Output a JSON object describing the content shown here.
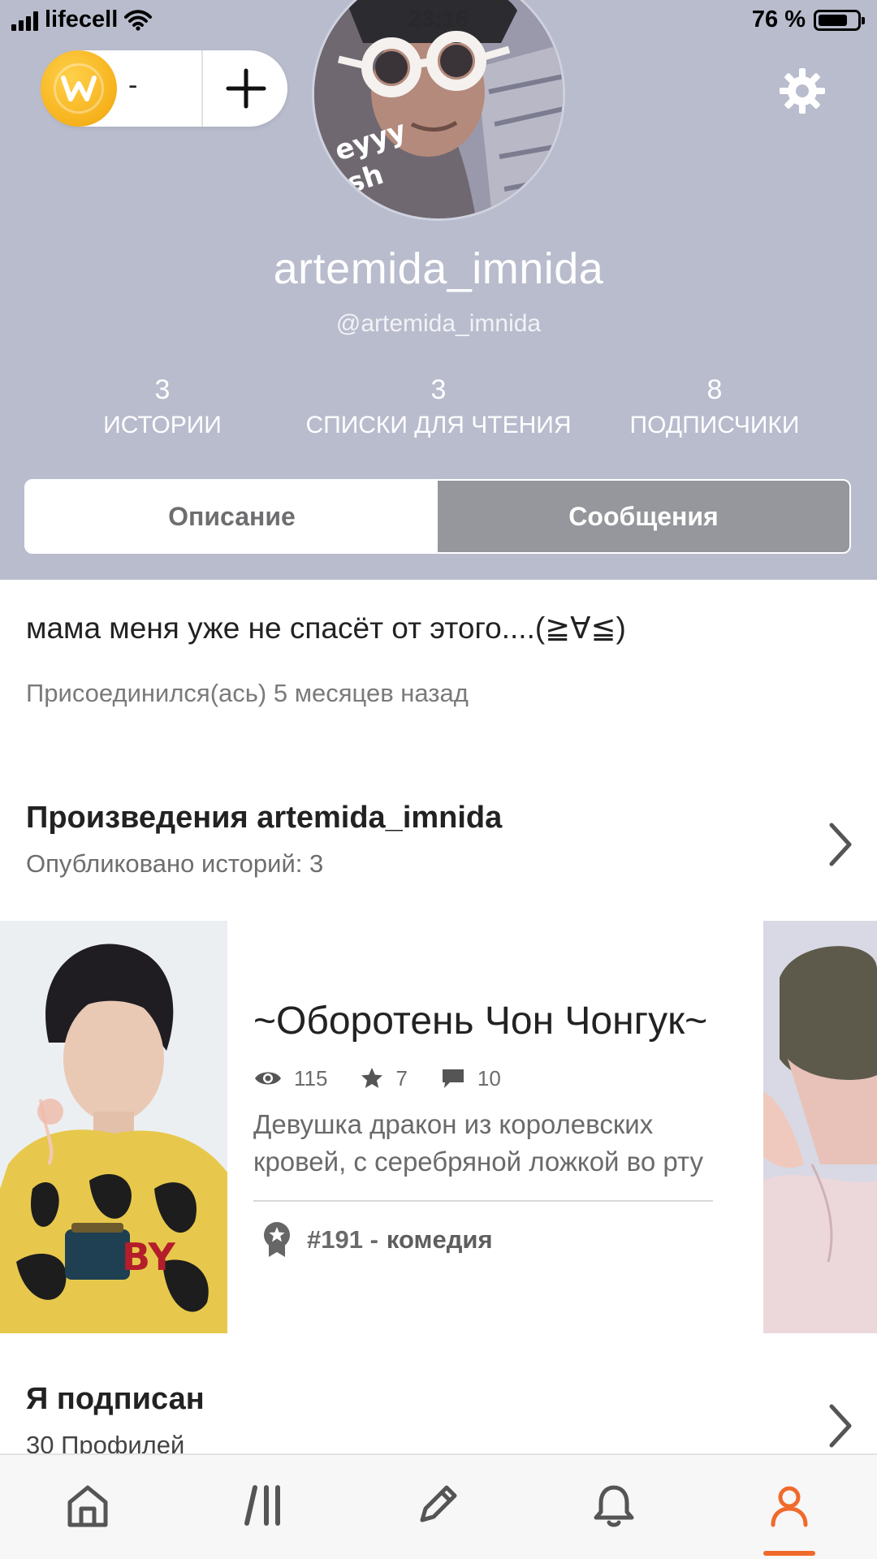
{
  "status_bar": {
    "carrier": "lifecell",
    "time": "23:16",
    "battery_percent": "76 %",
    "battery_level": 0.76
  },
  "coins": {
    "count": "-"
  },
  "profile": {
    "display_name": "artemida_imnida",
    "handle": "@artemida_imnida",
    "stats": [
      {
        "value": "3",
        "label": "ИСТОРИИ"
      },
      {
        "value": "3",
        "label": "СПИСКИ ДЛЯ ЧТЕНИЯ"
      },
      {
        "value": "8",
        "label": "ПОДПИСЧИКИ"
      }
    ],
    "tabs": [
      {
        "label": "Описание",
        "selected": true
      },
      {
        "label": "Сообщения",
        "selected": false
      }
    ],
    "bio": "мама меня уже не спасёт от этого....(≧∀≦)",
    "joined": "Присоединился(ась) 5 месяцев назад"
  },
  "works": {
    "title_prefix": "Произведения",
    "title_user": "artemida_imnida",
    "subtitle": "Опубликовано историй: 3",
    "story": {
      "title": "~Оборотень Чон Чонгук~",
      "views": "115",
      "votes": "7",
      "comments": "10",
      "desc_line1": "Девушка дракон из королевских",
      "desc_line2": "кровей, с серебряной ложкой во рту",
      "rank": "#191 -",
      "genre": "комедия"
    }
  },
  "following": {
    "title": "Я подписан",
    "subtitle": "30 Профилей"
  },
  "tabbar": {
    "items": [
      "home-icon",
      "library-icon",
      "write-icon",
      "notifications-icon",
      "profile-icon"
    ],
    "active": "profile-icon",
    "accent": "#f06a2b"
  },
  "colors": {
    "header_bg": "#b8bccd",
    "segment_inactive": "#96979c",
    "coin": "#f6b21c"
  }
}
